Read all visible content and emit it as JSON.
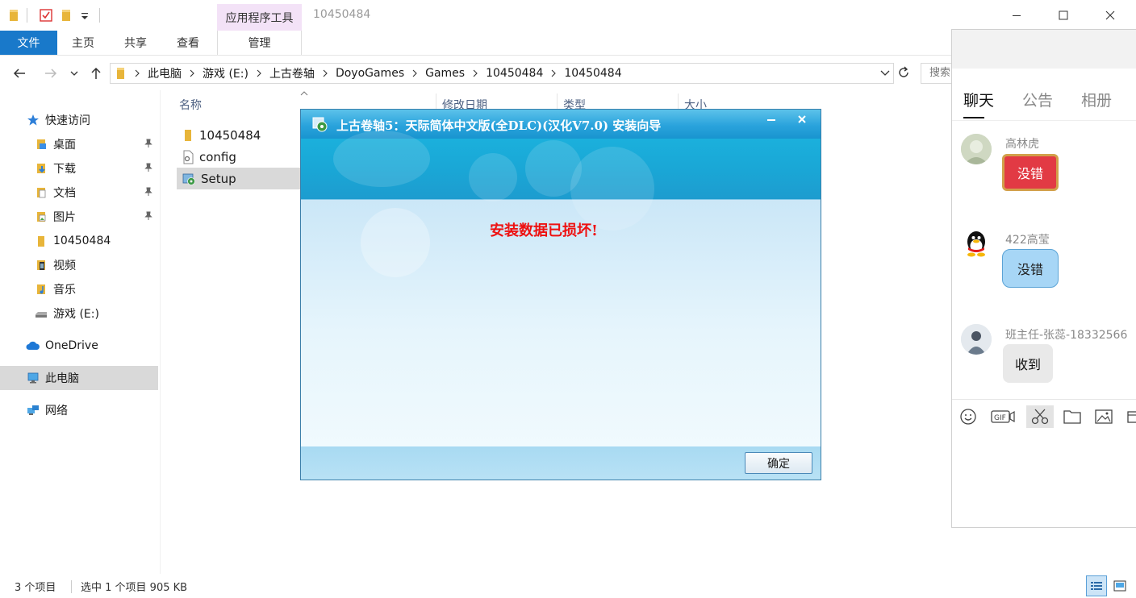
{
  "titlebar": {
    "context_tab": "应用程序工具",
    "window_title": "10450484"
  },
  "ribbon": {
    "tabs": [
      {
        "label": "文件"
      },
      {
        "label": "主页"
      },
      {
        "label": "共享"
      },
      {
        "label": "查看"
      },
      {
        "label": "管理"
      }
    ]
  },
  "address": {
    "crumbs": [
      "此电脑",
      "游戏 (E:)",
      "上古卷轴",
      "DoyoGames",
      "Games",
      "10450484",
      "10450484"
    ],
    "search_placeholder": "搜索"
  },
  "navpane": {
    "quick_access": "快速访问",
    "items": [
      {
        "label": "桌面"
      },
      {
        "label": "下载"
      },
      {
        "label": "文档"
      },
      {
        "label": "图片"
      },
      {
        "label": "10450484"
      },
      {
        "label": "视频"
      },
      {
        "label": "音乐"
      },
      {
        "label": "游戏 (E:)"
      }
    ],
    "onedrive": "OneDrive",
    "this_pc": "此电脑",
    "network": "网络"
  },
  "filelist": {
    "columns": {
      "name": "名称",
      "modified": "修改日期",
      "type": "类型",
      "size": "大小"
    },
    "rows": [
      {
        "name": "10450484"
      },
      {
        "name": "config"
      },
      {
        "name": "Setup"
      }
    ]
  },
  "status": {
    "count": "3 个项目",
    "selection": "选中 1 个项目  905 KB"
  },
  "dialog": {
    "title": "上古卷轴5：天际简体中文版(全DLC)(汉化V7.0) 安装向导",
    "message": "安装数据已损坏!",
    "ok_label": "确定"
  },
  "chat": {
    "tabs": [
      "聊天",
      "公告",
      "相册"
    ],
    "messages": [
      {
        "sender": "高林虎",
        "text": "没错"
      },
      {
        "sender": "422高莹",
        "text": "没错"
      },
      {
        "sender": "班主任-张蕊-18332566",
        "text": "收到"
      }
    ]
  },
  "colors": {
    "file_tab": "#1979ca",
    "dialog_title": "#2aa3dc",
    "error_text": "#ee1111"
  }
}
